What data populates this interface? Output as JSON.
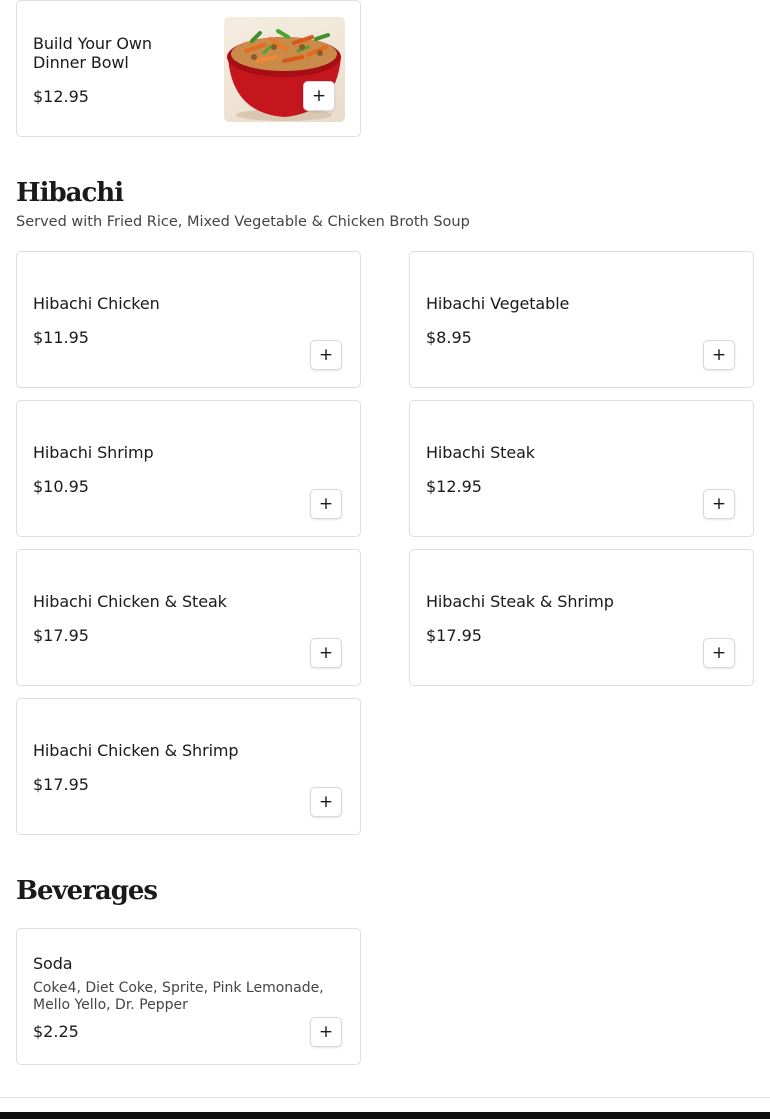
{
  "featured": {
    "name": "Build Your Own Dinner Bowl",
    "price": "$12.95",
    "image_icon": "dinner-bowl-photo",
    "add_icon": "plus-icon"
  },
  "hibachi": {
    "title": "Hibachi",
    "subtitle": "Served with Fried Rice, Mixed Vegetable & Chicken Broth Soup",
    "items": [
      {
        "name": "Hibachi Chicken",
        "price": "$11.95"
      },
      {
        "name": "Hibachi Vegetable",
        "price": "$8.95"
      },
      {
        "name": "Hibachi Shrimp",
        "price": "$10.95"
      },
      {
        "name": "Hibachi Steak",
        "price": "$12.95"
      },
      {
        "name": "Hibachi Chicken & Steak",
        "price": "$17.95"
      },
      {
        "name": "Hibachi Steak & Shrimp",
        "price": "$17.95"
      },
      {
        "name": "Hibachi Chicken & Shrimp",
        "price": "$17.95"
      }
    ]
  },
  "beverages": {
    "title": "Beverages",
    "items": [
      {
        "name": "Soda",
        "description": "Coke4, Diet Coke, Sprite, Pink Lemonade, Mello Yello, Dr. Pepper",
        "price": "$2.25"
      }
    ]
  },
  "ui": {
    "add_label": "+",
    "colors": {
      "border": "#dedede",
      "text": "#1a1a1a",
      "muted": "#444444",
      "footer": "#111111"
    }
  }
}
